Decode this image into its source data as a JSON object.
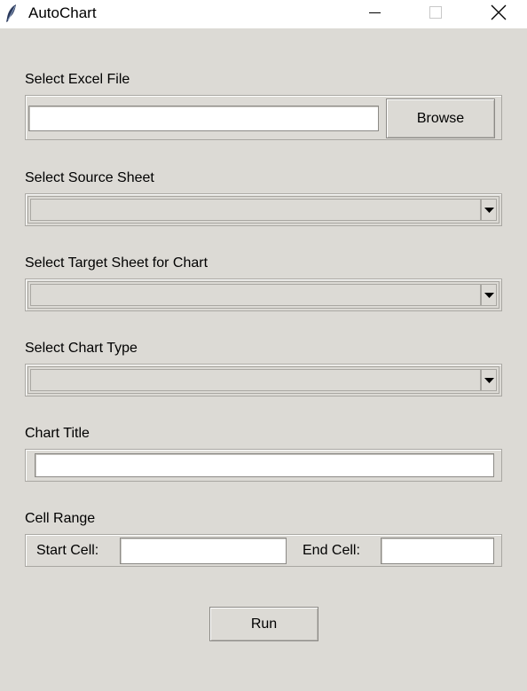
{
  "window": {
    "title": "AutoChart",
    "icon": "feather-icon",
    "controls": [
      "minimize-icon",
      "maximize-icon",
      "close-icon"
    ]
  },
  "excel_file": {
    "label": "Select Excel File",
    "value": "",
    "browse_label": "Browse"
  },
  "source_sheet": {
    "label": "Select Source Sheet",
    "selected": ""
  },
  "target_sheet": {
    "label": "Select Target Sheet for Chart",
    "selected": ""
  },
  "chart_type": {
    "label": "Select Chart Type",
    "selected": ""
  },
  "chart_title": {
    "label": "Chart Title",
    "value": ""
  },
  "cell_range": {
    "label": "Cell Range",
    "start_label": "Start Cell:",
    "start_value": "",
    "end_label": "End Cell:",
    "end_value": ""
  },
  "run_label": "Run",
  "colors": {
    "background": "#dcdad5",
    "titlebar": "#ffffff",
    "field": "#ffffff"
  }
}
